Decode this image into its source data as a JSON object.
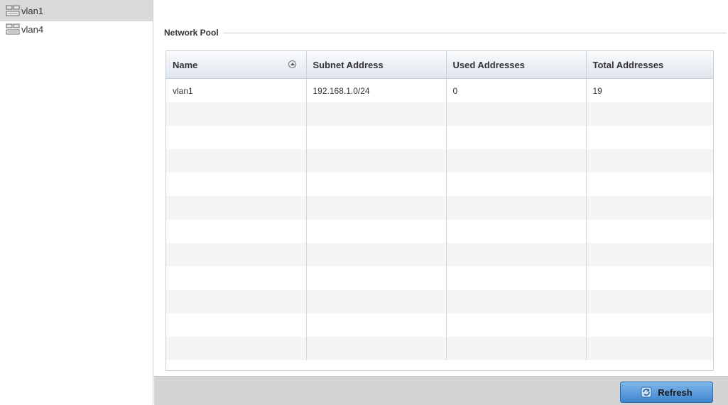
{
  "sidebar": {
    "items": [
      {
        "label": "vlan1",
        "icon": "network-icon",
        "selected": true
      },
      {
        "label": "vlan4",
        "icon": "network-icon",
        "selected": false
      }
    ]
  },
  "section": {
    "legend": "Network Pool"
  },
  "table": {
    "columns": [
      "Name",
      "Subnet Address",
      "Used Addresses",
      "Total Addresses"
    ],
    "sort_icon": "sort-ascending-icon",
    "rows": [
      [
        "vlan1",
        "192.168.1.0/24",
        "0",
        "19"
      ]
    ]
  },
  "footer": {
    "refresh_label": "Refresh",
    "refresh_icon": "refresh-icon"
  },
  "colors": {
    "header_grad_top": "#fafbfc",
    "header_grad_bottom": "#dfe6ee",
    "button_accent": "#3e86cf",
    "footer_bg": "#d4d4d4"
  }
}
